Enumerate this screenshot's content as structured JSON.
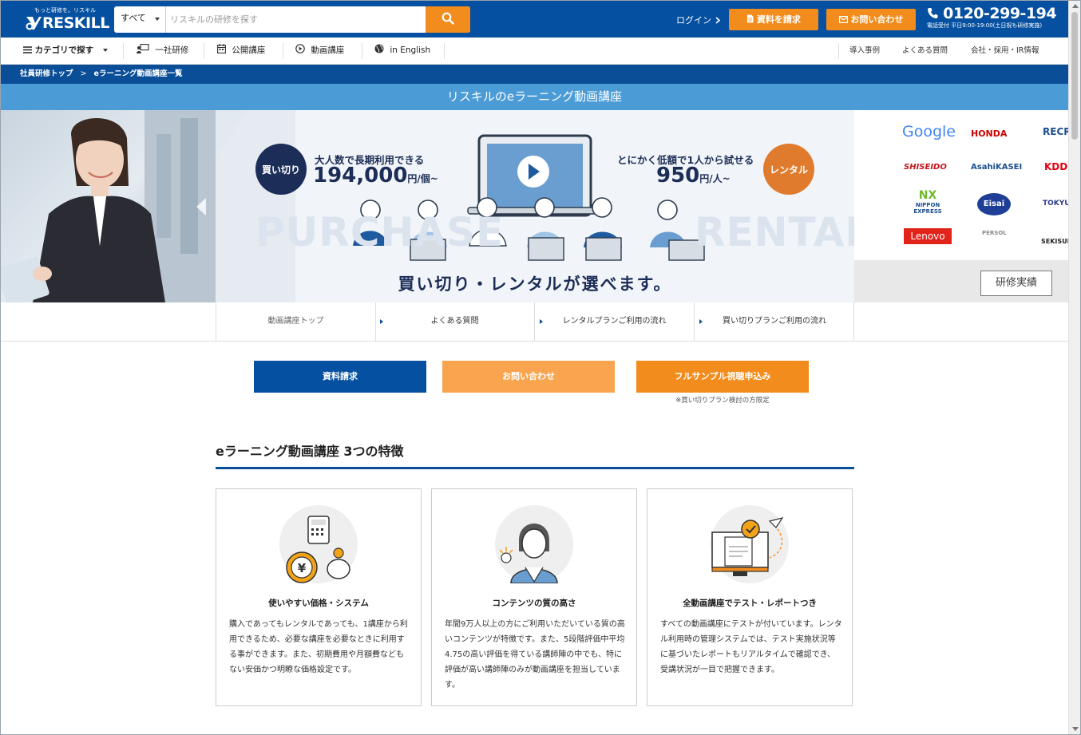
{
  "header": {
    "logo_tagline": "もっと研修を。リスキル",
    "logo_text": "RESKILL",
    "search_category": "すべて",
    "search_placeholder": "リスキルの研修を探す",
    "login_label": "ログイン",
    "request_docs_label": "資料を請求",
    "contact_label": "お問い合わせ",
    "phone": "0120-299-194",
    "phone_note": "電話受付 平日9:00-19:00(土日祝も研修実施)"
  },
  "nav": {
    "category": "カテゴリで探す",
    "items": [
      "一社研修",
      "公開講座",
      "動画講座",
      "in English"
    ],
    "right": [
      "導入事例",
      "よくある質問",
      "会社・採用・IR情報"
    ]
  },
  "breadcrumb": {
    "home": "社員研修トップ",
    "separator": ">",
    "current": "eラーニング動画講座一覧"
  },
  "page_title": "リスキルのeラーニング動画講座",
  "banner": {
    "buy_badge": "買い切り",
    "buy_lead": "大人数で長期利用できる",
    "buy_price": "194,000",
    "buy_unit": "円/個~",
    "rent_badge": "レンタル",
    "rent_lead": "とにかく低額で1人から試せる",
    "rent_price": "950",
    "rent_unit": "円/人~",
    "bg_left": "PURCHASE",
    "bg_right": "RENTAL",
    "headline": "買い切り・レンタルが選べます。"
  },
  "client_logos": [
    "Google",
    "HONDA",
    "RECRUIT",
    "SHISEIDO",
    "AsahiKASEI",
    "KDDI",
    "NIPPON EXPRESS",
    "Eisai",
    "TOKYU",
    "Lenovo",
    "PERSOL",
    "SEKISUI"
  ],
  "achievements_label": "研修実績",
  "subnav": [
    "動画講座トップ",
    "よくある質問",
    "レンタルプランご利用の流れ",
    "買い切りプランご利用の流れ"
  ],
  "cta": {
    "docs": "資料請求",
    "contact": "お問い合わせ",
    "sample": "フルサンプル視聴申込み",
    "sample_note": "※買い切りプラン検討の方限定"
  },
  "features": {
    "title": "eラーニング動画講座 3つの特徴",
    "cards": [
      {
        "title": "使いやすい価格・システム",
        "body": "購入であってもレンタルであっても、1講座から利用できるため、必要な講座を必要なときに利用する事ができます。また、初期費用や月額費などもない安価かつ明瞭な価格設定です。"
      },
      {
        "title": "コンテンツの質の高さ",
        "body": "年間9万人以上の方にご利用いただいている質の高いコンテンツが特徴です。また、5段階評価中平均4.75の高い評価を得ている講師陣の中でも、特に評価が高い講師陣のみが動画講座を担当しています。"
      },
      {
        "title": "全動画講座でテスト・レポートつき",
        "body": "すべての動画講座にテストが付いています。レンタル利用時の管理システムでは、テスト実施状況等に基づいたレポートもリアルタイムで確認でき、受講状況が一目で把握できます。"
      }
    ]
  },
  "colors": {
    "brand_blue": "#0550a0",
    "accent_orange": "#f28c1c",
    "light_orange": "#f9a54f",
    "title_blue": "#4a9bd6"
  }
}
